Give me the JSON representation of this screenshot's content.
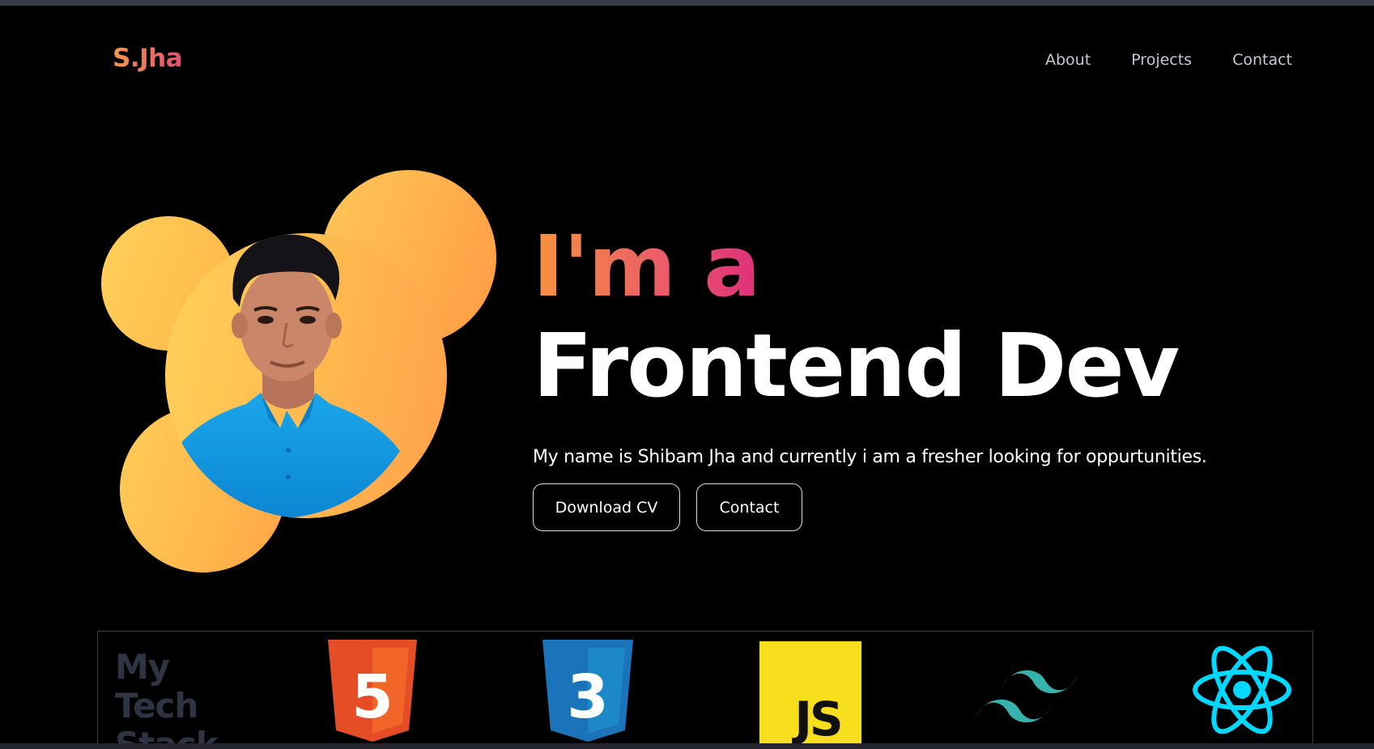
{
  "logo": "S.Jha",
  "nav": {
    "about": "About",
    "projects": "Projects",
    "contact": "Contact"
  },
  "hero": {
    "line1": "I'm a",
    "line2": "Frontend Dev",
    "tagline": "My name is Shibam Jha and currently i am a fresher looking for oppurtunities.",
    "download_cv": "Download CV",
    "contact": "Contact"
  },
  "tech_stack": {
    "title_words": [
      "My",
      "Tech",
      "Stack"
    ],
    "items": [
      {
        "icon": "html5-icon",
        "label": "5",
        "color": "#e44d26"
      },
      {
        "icon": "css3-icon",
        "label": "3",
        "color": "#1b73ba"
      },
      {
        "icon": "javascript-icon",
        "label": "JS",
        "color": "#f7df1e"
      },
      {
        "icon": "tailwind-icon",
        "color": "#38b2ac"
      },
      {
        "icon": "react-icon",
        "color": "#00d8ff"
      }
    ]
  },
  "colors": {
    "background": "#000000",
    "accent_orange": "#f6974a",
    "accent_pink": "#e54f73",
    "blob_yellow": "#ffc04f"
  }
}
